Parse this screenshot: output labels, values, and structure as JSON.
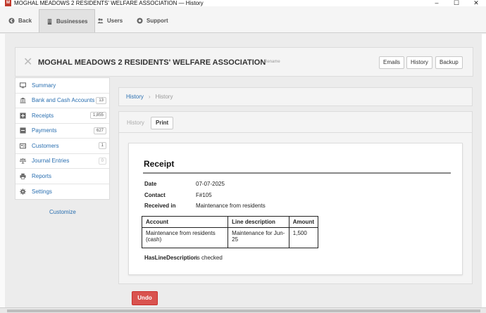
{
  "window": {
    "app_icon_letter": "M",
    "title": "MOGHAL MEADOWS 2 RESIDENTS' WELFARE ASSOCIATION — History",
    "controls": [
      "–",
      "☐",
      "✕"
    ]
  },
  "toolbar": {
    "back_label": "Back",
    "businesses_label": "Businesses",
    "users_label": "Users",
    "support_label": "Support",
    "icons": {
      "back": "back-arrow-icon",
      "businesses": "building-icon",
      "users": "users-icon",
      "support": "support-icon"
    }
  },
  "header": {
    "close_glyph": "✕",
    "business_name": "MOGHAL MEADOWS 2 RESIDENTS' WELFARE ASSOCIATION",
    "rename_label": "Rename",
    "emails_label": "Emails",
    "history_label": "History",
    "backup_label": "Backup"
  },
  "sidebar": {
    "items": [
      {
        "label": "Summary",
        "count": "",
        "icon": "monitor-icon"
      },
      {
        "label": "Bank and Cash Accounts",
        "count": "13",
        "icon": "bank-icon"
      },
      {
        "label": "Receipts",
        "count": "1,855",
        "icon": "plus-icon"
      },
      {
        "label": "Payments",
        "count": "627",
        "icon": "minus-icon"
      },
      {
        "label": "Customers",
        "count": "1",
        "icon": "customers-icon"
      },
      {
        "label": "Journal Entries",
        "count": "0",
        "icon": "scale-icon"
      },
      {
        "label": "Reports",
        "count": "",
        "icon": "printer-icon"
      },
      {
        "label": "Settings",
        "count": "",
        "icon": "gear-icon"
      }
    ],
    "customize_label": "Customize"
  },
  "breadcrumb": {
    "link": "History",
    "separator": "›",
    "current": "History"
  },
  "panel": {
    "title": "History",
    "print_label": "Print"
  },
  "receipt": {
    "title": "Receipt",
    "date_label": "Date",
    "date": "07-07-2025",
    "contact_label": "Contact",
    "contact": "F#105",
    "received_in_label": "Received in",
    "received_in": "Maintenance from residents",
    "columns": [
      "Account",
      "Line description",
      "Amount"
    ],
    "lines": [
      {
        "account": "Maintenance from residents (cash)",
        "description": "Maintenance for Jun-25",
        "amount": "1,500"
      }
    ],
    "flag_label": "HasLineDescription",
    "flag_value": "is checked"
  },
  "actions": {
    "undo_label": "Undo"
  },
  "colors": {
    "link": "#2a6fb0",
    "danger": "#d9534f",
    "app_icon": "#c0392b"
  }
}
